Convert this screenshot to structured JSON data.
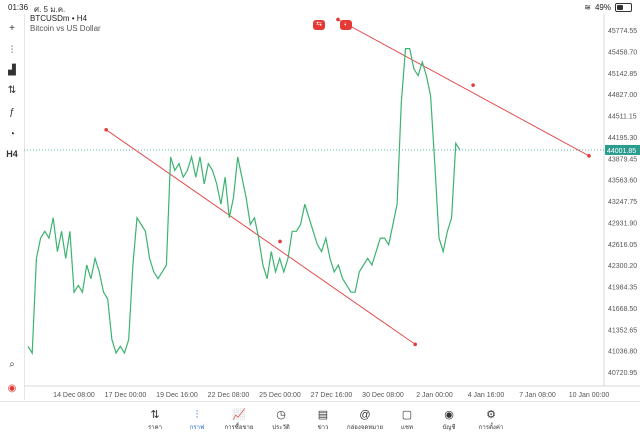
{
  "status_bar": {
    "time": "01:36",
    "date": "ศ. 5 ม.ค.",
    "battery": "49%"
  },
  "symbol": {
    "title": "BTCUSDm • H4",
    "description": "Bitcoin vs US Dollar"
  },
  "toolbar": {
    "items": [
      {
        "icon": "crosshair-icon",
        "glyph": "+"
      },
      {
        "icon": "candles-icon",
        "glyph": "⫶"
      },
      {
        "icon": "bars-icon",
        "glyph": "▟"
      },
      {
        "icon": "indicator-icon",
        "glyph": "⇅"
      },
      {
        "icon": "function-icon",
        "glyph": "ƒ"
      },
      {
        "icon": "shapes-icon",
        "glyph": "◔"
      },
      {
        "icon": "timeframe-label",
        "glyph": "H4"
      }
    ]
  },
  "chart_data": {
    "type": "line",
    "y_ticks": [
      "45774.55",
      "45458.70",
      "45142.85",
      "44827.00",
      "44511.15",
      "44195.30",
      "43879.45",
      "43563.60",
      "43247.75",
      "42931.90",
      "42616.05",
      "42300.20",
      "41984.35",
      "41668.50",
      "41352.65",
      "41036.80",
      "40720.95"
    ],
    "y_range": [
      40720.95,
      45774.55
    ],
    "x_ticks": [
      "14 Dec 08:00",
      "17 Dec 00:00",
      "19 Dec 16:00",
      "22 Dec 08:00",
      "25 Dec 00:00",
      "27 Dec 16:00",
      "30 Dec 08:00",
      "2 Jan 00:00",
      "4 Jan 16:00",
      "7 Jan 08:00",
      "10 Jan 00:00"
    ],
    "current_price": "44001.85",
    "colors": {
      "line": "#3cb371",
      "trendline": "#e23b3b",
      "current": "#2a9d8f"
    },
    "series": [
      {
        "values": [
          41100,
          41000,
          42400,
          42700,
          42800,
          42700,
          43000,
          42500,
          42800,
          42400,
          42800,
          41900,
          42000,
          41900,
          42300,
          42100,
          42400,
          42200,
          41900,
          41800,
          41200,
          41000,
          41100,
          41000,
          41200,
          42300,
          43000,
          42900,
          42800,
          42400,
          42200,
          42100,
          42200,
          42300,
          43900,
          43700,
          43800,
          43600,
          43700,
          43900,
          43600,
          43900,
          43500,
          43800,
          43700,
          43500,
          43200,
          43600,
          43000,
          43300,
          43900,
          43600,
          43300,
          42900,
          43000,
          42700,
          42300,
          42100,
          42500,
          42200,
          42400,
          42200,
          42400,
          42800,
          42800,
          42900,
          43200,
          43000,
          42800,
          42600,
          42500,
          42700,
          42400,
          42200,
          42300,
          42100,
          42000,
          41900,
          41900,
          42200,
          42300,
          42400,
          42300,
          42500,
          42700,
          42700,
          42600,
          42900,
          43200,
          44700,
          45500,
          45500,
          45200,
          45100,
          45300,
          45100,
          44800,
          43800,
          42700,
          42500,
          42800,
          43000,
          44100,
          44000
        ]
      }
    ],
    "trendlines": [
      {
        "points": [
          [
            "16 Dec",
            44300
          ],
          [
            "25 Dec",
            42650
          ],
          [
            "1 Jan",
            41130
          ]
        ]
      },
      {
        "points": [
          [
            "28 Dec",
            45930
          ],
          [
            "4 Jan",
            44960
          ],
          [
            "10 Jan",
            43915
          ]
        ]
      }
    ]
  },
  "badges": [
    {
      "icon": "trade-badge-icon",
      "text": "⇆",
      "color": "#e53935"
    },
    {
      "icon": "timer-badge-icon",
      "text": "◐",
      "color": "#e53935"
    }
  ],
  "tabs": [
    {
      "label": "ราคา",
      "icon": "quotes-icon",
      "glyph": "⇅"
    },
    {
      "label": "กราฟ",
      "icon": "chart-icon",
      "glyph": "⫶",
      "active": true
    },
    {
      "label": "การซื้อขาย",
      "icon": "trade-icon",
      "glyph": "📈"
    },
    {
      "label": "ประวัติ",
      "icon": "history-icon",
      "glyph": "◷"
    },
    {
      "label": "ข่าว",
      "icon": "news-icon",
      "glyph": "▤"
    },
    {
      "label": "กล่องจดหมาย",
      "icon": "mailbox-icon",
      "glyph": "@"
    },
    {
      "label": "แชท",
      "icon": "chat-icon",
      "glyph": "▢"
    },
    {
      "label": "บัญชี",
      "icon": "account-icon",
      "glyph": "◉"
    },
    {
      "label": "การตั้งค่า",
      "icon": "settings-icon",
      "glyph": "⚙"
    }
  ]
}
